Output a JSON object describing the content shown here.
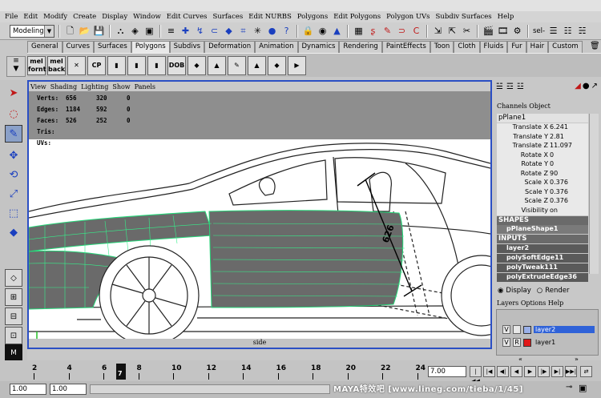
{
  "menubar": [
    "File",
    "Edit",
    "Modify",
    "Create",
    "Display",
    "Window",
    "Edit Curves",
    "Surfaces",
    "Edit NURBS",
    "Polygons",
    "Edit Polygons",
    "Polygon UVs",
    "Subdiv Surfaces",
    "Help"
  ],
  "status_line": {
    "mode": "Modeling",
    "sel_label": "sel-"
  },
  "shelf_tabs": [
    "General",
    "Curves",
    "Surfaces",
    "Polygons",
    "Subdivs",
    "Deformation",
    "Animation",
    "Dynamics",
    "Rendering",
    "PaintEffects",
    "Toon",
    "Cloth",
    "Fluids",
    "Fur",
    "Hair",
    "Custom"
  ],
  "shelf_buttons": [
    {
      "label": "mel\nfornt",
      "style": "light"
    },
    {
      "label": "mel\nback",
      "style": "light"
    },
    {
      "label": "✕",
      "style": "light"
    },
    {
      "label": "CP",
      "style": "light"
    },
    {
      "label": "▮",
      "style": "light"
    },
    {
      "label": "▮",
      "style": "light"
    },
    {
      "label": "▮",
      "style": "light"
    },
    {
      "label": "DOB",
      "style": "light"
    },
    {
      "label": "◆",
      "style": "light"
    },
    {
      "label": "▲",
      "style": "light"
    },
    {
      "label": "✎",
      "style": "light"
    },
    {
      "label": "▲",
      "style": "light"
    },
    {
      "label": "◆",
      "style": "light"
    },
    {
      "label": "▶",
      "style": "light"
    }
  ],
  "viewport": {
    "menu": [
      "View",
      "Shading",
      "Lighting",
      "Show",
      "Panels"
    ],
    "hud": [
      {
        "label": "Verts:",
        "a": "656",
        "b": "320",
        "c": "0"
      },
      {
        "label": "Edges:",
        "a": "1184",
        "b": "592",
        "c": "0"
      },
      {
        "label": "Faces:",
        "a": "526",
        "b": "252",
        "c": "0"
      },
      {
        "label": "Tris:",
        "a": "",
        "b": "",
        "c": ""
      },
      {
        "label": "UVs:",
        "a": "",
        "b": "",
        "c": ""
      }
    ],
    "camera_label": "side",
    "dimension_label": "626"
  },
  "channel_box": {
    "menu": [
      "Channels",
      "Object"
    ],
    "object": "pPlane1",
    "channels": [
      {
        "name": "Translate X",
        "value": "6.241"
      },
      {
        "name": "Translate Y",
        "value": "2.81"
      },
      {
        "name": "Translate Z",
        "value": "11.097"
      },
      {
        "name": "Rotate X",
        "value": "0"
      },
      {
        "name": "Rotate Y",
        "value": "0"
      },
      {
        "name": "Rotate Z",
        "value": "90"
      },
      {
        "name": "Scale X",
        "value": "0.376"
      },
      {
        "name": "Scale Y",
        "value": "0.376"
      },
      {
        "name": "Scale Z",
        "value": "0.376"
      },
      {
        "name": "Visibility",
        "value": "on"
      }
    ],
    "shapes_header": "SHAPES",
    "shape_node": "pPlaneShape1",
    "inputs_header": "INPUTS",
    "inputs": [
      "layer2",
      "polySoftEdge11",
      "polyTweak111",
      "polyExtrudeEdge36"
    ]
  },
  "layer_editor": {
    "display_label": "Display",
    "render_label": "Render",
    "menu": [
      "Layers",
      "Options",
      "Help"
    ],
    "layers": [
      {
        "v": "V",
        "p": "",
        "name": "layer2",
        "color": "#2f62d8",
        "selected": true
      },
      {
        "v": "V",
        "p": "R",
        "name": "layer1",
        "color": "#e01818",
        "selected": false
      }
    ]
  },
  "time_slider": {
    "ticks": [
      "2",
      "4",
      "6",
      "8",
      "10",
      "12",
      "14",
      "16",
      "18",
      "20",
      "22",
      "24"
    ],
    "current_frame": "7",
    "current_time": "7.00"
  },
  "range": {
    "start": "1.00",
    "start2": "1.00"
  },
  "watermark": "MAYA特效吧   [www.lineg.com/tieba/1/45]"
}
